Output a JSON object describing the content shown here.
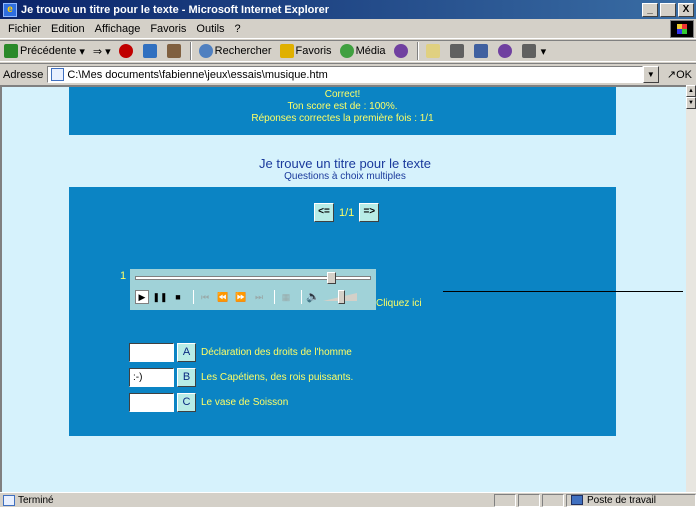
{
  "window": {
    "title": "Je trouve un titre pour le texte - Microsoft Internet Explorer",
    "minimize": "_",
    "maximize": " ",
    "close": "X"
  },
  "menu": [
    "Fichier",
    "Edition",
    "Affichage",
    "Favoris",
    "Outils",
    "?"
  ],
  "toolbar": {
    "back": "Précédente",
    "search": "Rechercher",
    "favorites": "Favoris",
    "media": "Média"
  },
  "address": {
    "label": "Adresse",
    "value": "C:\\Mes documents\\fabienne\\jeux\\essais\\musique.htm",
    "go": "OK"
  },
  "feedback": {
    "line1": "Correct!",
    "line2": "Ton score est de : 100%.",
    "line3": "Réponses correctes la première fois : 1/1"
  },
  "page": {
    "title": "Je trouve un titre pour le texte",
    "subtitle": "Questions à choix multiples"
  },
  "nav": {
    "prev": "<=",
    "counter": "1/1",
    "next": "=>"
  },
  "player": {
    "track_number": "1",
    "seek_position": 0.85,
    "volume_level": 0.55,
    "click_here": "Cliquez ici"
  },
  "answers": [
    {
      "input": "",
      "letter": "A",
      "text": "Déclaration des droits de l'homme"
    },
    {
      "input": ":-)",
      "letter": "B",
      "text": "Les Capétiens, des rois puissants."
    },
    {
      "input": "",
      "letter": "C",
      "text": "Le vase de Soisson"
    }
  ],
  "status": {
    "text": "Terminé",
    "zone": "Poste de travail"
  }
}
